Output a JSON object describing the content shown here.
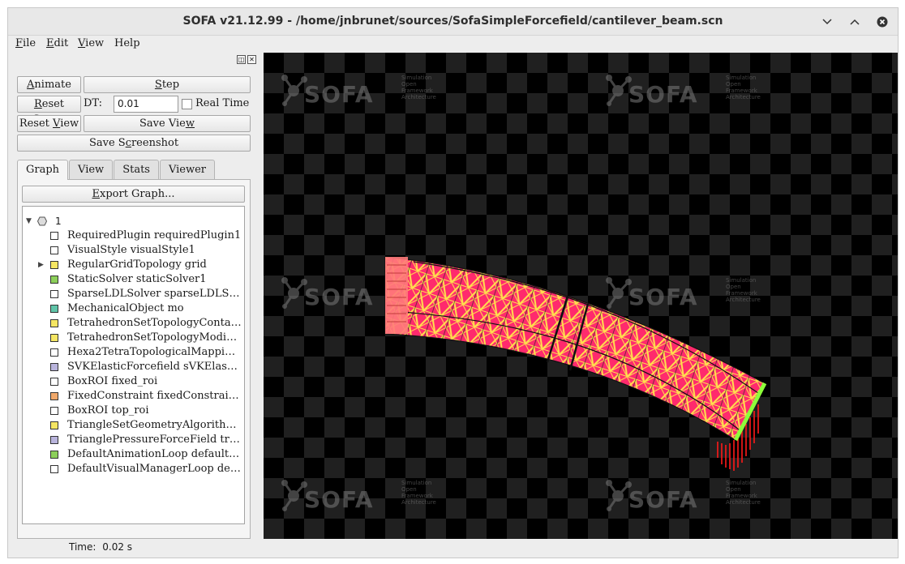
{
  "window": {
    "title": "SOFA v21.12.99 - /home/jnbrunet/sources/SofaSimpleForcefield/cantilever_beam.scn"
  },
  "menubar": {
    "file": {
      "prefix": "",
      "accel": "F",
      "rest": "ile"
    },
    "edit": {
      "prefix": "",
      "accel": "E",
      "rest": "dit"
    },
    "view": {
      "prefix": "",
      "accel": "V",
      "rest": "iew"
    },
    "help": "Help"
  },
  "controls": {
    "animate": {
      "prefix": "",
      "accel": "A",
      "rest": "nimate"
    },
    "step": {
      "prefix": "",
      "accel": "S",
      "rest": "tep"
    },
    "reset_scene": {
      "prefix": "",
      "accel": "R",
      "rest": "eset Scene"
    },
    "dt_label": "DT:",
    "dt_value": "0.01",
    "real_time_label": "Real Time",
    "reset_view": {
      "prefix": "Reset ",
      "accel": "V",
      "rest": "iew"
    },
    "save_view": {
      "prefix": "Save Vie",
      "accel": "w",
      "rest": ""
    },
    "save_screenshot": {
      "prefix": "Save S",
      "accel": "c",
      "rest": "reenshot"
    }
  },
  "tabs": [
    "Graph",
    "View",
    "Stats",
    "Viewer"
  ],
  "graph": {
    "export": {
      "prefix": "",
      "accel": "E",
      "rest": "xport Graph..."
    },
    "root_label": "1",
    "nodes": [
      {
        "label": "RequiredPlugin requiredPlugin1",
        "color": "#ffffff"
      },
      {
        "label": "VisualStyle visualStyle1",
        "color": "#ffffff"
      },
      {
        "label": "RegularGridTopology grid",
        "color": "#f5e663"
      },
      {
        "label": "StaticSolver staticSolver1",
        "color": "#8ccf5a"
      },
      {
        "label": "SparseLDLSolver sparseLDLSolver1",
        "color": "#ffffff"
      },
      {
        "label": "MechanicalObject mo",
        "color": "#5fc4a8"
      },
      {
        "label": "TetrahedronSetTopologyContainer topo",
        "color": "#f5e663"
      },
      {
        "label": "TetrahedronSetTopologyModifier modifier",
        "color": "#f5e663"
      },
      {
        "label": "Hexa2TetraTopologicalMapping hexa2tetra",
        "color": "#ffffff"
      },
      {
        "label": "SVKElasticForcefield sVKElasticForcefield",
        "color": "#b9b4dc"
      },
      {
        "label": "BoxROI fixed_roi",
        "color": "#ffffff"
      },
      {
        "label": "FixedConstraint fixedConstraint1",
        "color": "#f0a86a"
      },
      {
        "label": "BoxROI top_roi",
        "color": "#ffffff"
      },
      {
        "label": "TriangleSetGeometryAlgorithms triangleGeometry",
        "color": "#f5e663"
      },
      {
        "label": "TrianglePressureForceField trianglePressure",
        "color": "#b9b4dc"
      },
      {
        "label": "DefaultAnimationLoop defaultAnimationLoop",
        "color": "#8ccf5a"
      },
      {
        "label": "DefaultVisualManagerLoop defaultVisualManagerLoop",
        "color": "#ffffff"
      }
    ]
  },
  "status": {
    "time_label": "Time:",
    "time_value": "0.02 s"
  },
  "viewer": {
    "logo_word": "SOFA",
    "logo_sub": [
      "Simulation",
      "Open",
      "Framework",
      "Architecture"
    ],
    "mesh_colors": {
      "fill": "#ff2a6d",
      "stripe": "#ffe14d",
      "edge": "#111111",
      "fixed": "#ff7b7b",
      "pressure": "#8cff3a",
      "force": "#ff1a1a"
    }
  }
}
